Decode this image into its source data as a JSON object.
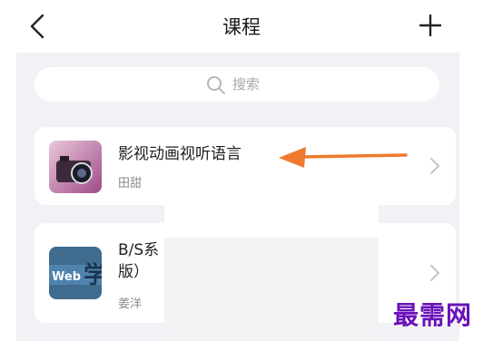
{
  "header": {
    "title": "课程",
    "back_icon": "chevron-left-icon",
    "add_icon": "plus-icon"
  },
  "search": {
    "placeholder": "搜索",
    "icon": "search-icon"
  },
  "courses": [
    {
      "title": "影视动画视听语言",
      "teacher": "田甜",
      "thumbnail": "camera-thumbnail"
    },
    {
      "title": "B/S系",
      "title_line2": "版）",
      "teacher": "姜洋",
      "thumbnail": "web-course-thumbnail",
      "thumbnail_text": "Web"
    }
  ],
  "annotation": {
    "arrow_color": "#ee7a2e"
  },
  "watermark": "最需网",
  "colors": {
    "background": "#f1f2f5",
    "card": "#ffffff",
    "watermark": "#6a12b8"
  }
}
